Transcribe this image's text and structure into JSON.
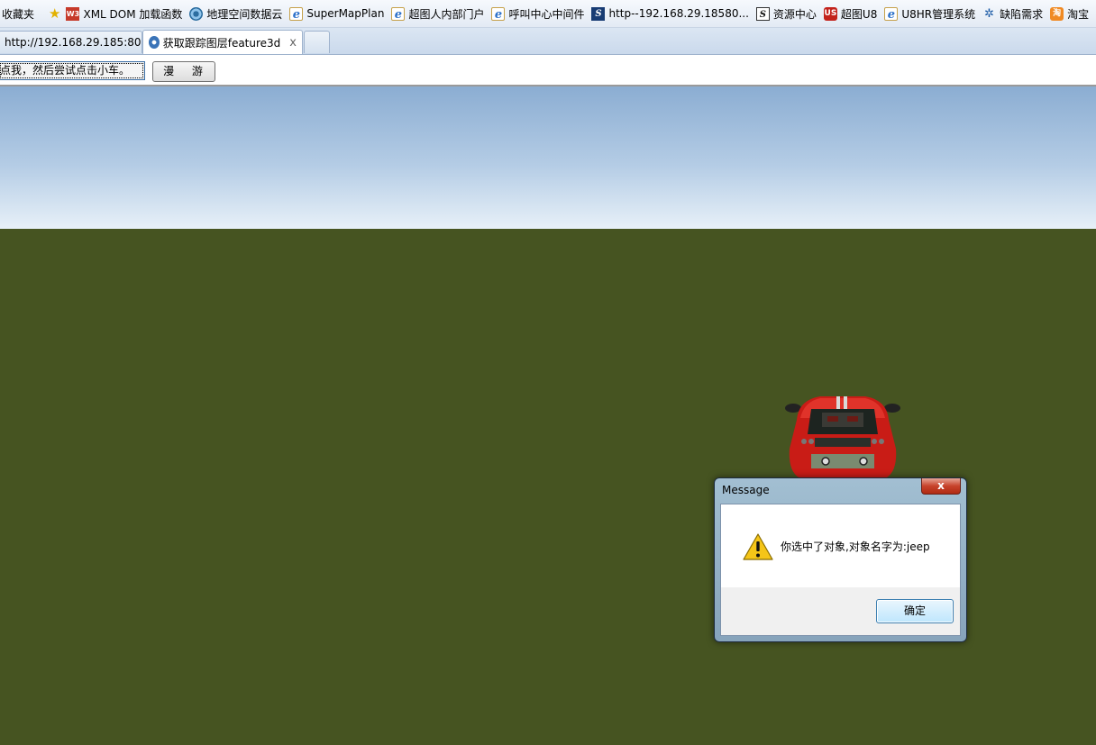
{
  "favorites_bar": {
    "label": "收藏夹",
    "items": [
      {
        "label": "XML DOM 加载函数",
        "icon": "w3-icon"
      },
      {
        "label": "地理空间数据云",
        "icon": "globe-eye-icon"
      },
      {
        "label": "SuperMapPlan",
        "icon": "ie-page-icon"
      },
      {
        "label": "超图人内部门户",
        "icon": "ie-page-icon"
      },
      {
        "label": "呼叫中心中间件",
        "icon": "ie-page-icon"
      },
      {
        "label": "http--192.168.29.18580...",
        "icon": "s-logo-icon"
      },
      {
        "label": "资源中心",
        "icon": "s-outline-icon"
      },
      {
        "label": "超图U8",
        "icon": "u8-icon"
      },
      {
        "label": "U8HR管理系统",
        "icon": "ie-page-icon"
      },
      {
        "label": "缺陷需求",
        "icon": "bulb-icon"
      },
      {
        "label": "淘宝",
        "icon": "taobao-icon"
      }
    ]
  },
  "tabs": [
    {
      "label": "http://192.168.29.185:80...",
      "active": false
    },
    {
      "label": "获取跟踪图层feature3d",
      "active": true,
      "close_glyph": "x"
    }
  ],
  "toolbar": {
    "hint_value": "点我，然后尝试点击小车。",
    "roam_button": "漫 游"
  },
  "dialog": {
    "title": "Message",
    "close_glyph": "x",
    "message": "你选中了对象,对象名字为:jeep",
    "ok_button": "确定",
    "icon": "warning-icon"
  },
  "colors": {
    "ground": "#465421",
    "sky_top": "#8badd2",
    "sky_horizon": "#e7f0f8",
    "car": "#d0201a"
  }
}
